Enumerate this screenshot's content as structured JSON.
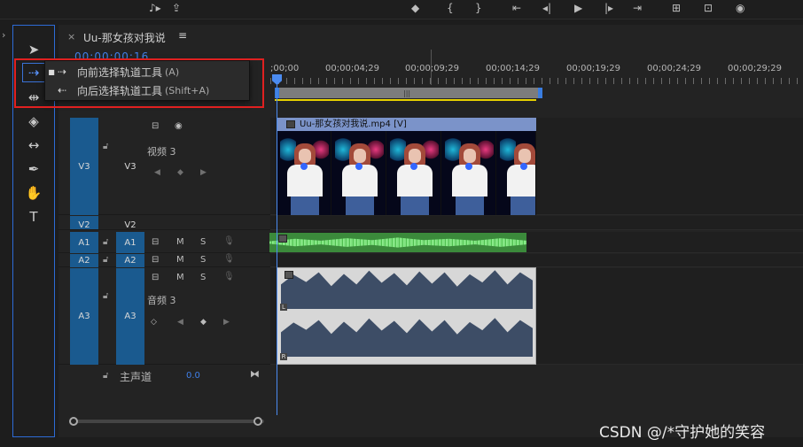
{
  "top_toolbar": {
    "icons": [
      "add-marker-icon",
      "in-point-icon",
      "out-point-icon",
      "go-to-in-icon",
      "step-back-icon",
      "play-icon",
      "step-forward-icon",
      "go-to-out-icon",
      "insert-icon",
      "overwrite-icon",
      "lift-icon",
      "export-frame-icon"
    ]
  },
  "sequence": {
    "tab_label": "Uu-那女孩对我说",
    "close_symbol": "×",
    "menu_symbol": "≡",
    "timecode": "00;00;00;16"
  },
  "ruler": {
    "labels": [
      ";00;00",
      "00;00;04;29",
      "00;00;09;29",
      "00;00;14;29",
      "00;00;19;29",
      "00;00;24;29",
      "00;00;29;29"
    ]
  },
  "popup_menu": {
    "items": [
      {
        "label": "向前选择轨道工具",
        "shortcut": "(A)",
        "selected": true,
        "icon": "track-select-forward-icon"
      },
      {
        "label": "向后选择轨道工具",
        "shortcut": "(Shift+A)",
        "selected": false,
        "icon": "track-select-backward-icon"
      }
    ]
  },
  "tracks": {
    "v3": {
      "src": "V3",
      "tgt": "V3",
      "name": "视频 3"
    },
    "v2": {
      "src": "V2",
      "tgt": "V2"
    },
    "a1": {
      "src": "A1",
      "tgt": "A1",
      "m": "M",
      "s": "S"
    },
    "a2": {
      "src": "A2",
      "tgt": "A2",
      "m": "M",
      "s": "S"
    },
    "a3": {
      "src": "A3",
      "tgt": "A3",
      "m": "M",
      "s": "S",
      "name": "音频 3"
    }
  },
  "clips": {
    "video_clip_label": "Uu-那女孩对我说.mp4 [V]",
    "audio_channel_labels": [
      "L",
      "R"
    ]
  },
  "master": {
    "label": "主声道",
    "value": "0.0"
  },
  "watermark": "CSDN @/*守护她的笑容",
  "colors": {
    "accent_blue": "#3f7fe8",
    "track_patch": "#1a5a8f",
    "highlight_red": "#e02020",
    "work_area_yellow": "#e8d200",
    "audio_green": "#3b8a3b"
  }
}
